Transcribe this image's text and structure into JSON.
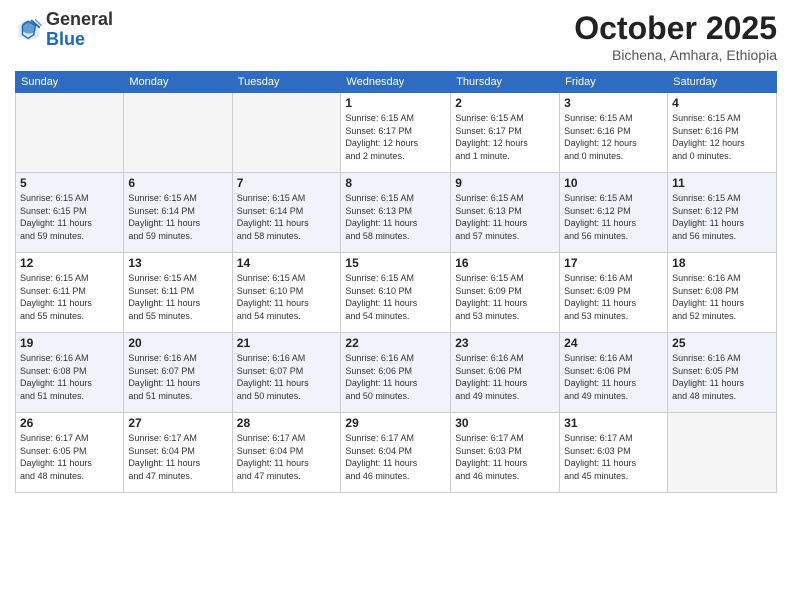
{
  "header": {
    "logo": {
      "line1": "General",
      "line2": "Blue"
    },
    "title": "October 2025",
    "location": "Bichena, Amhara, Ethiopia"
  },
  "weekdays": [
    "Sunday",
    "Monday",
    "Tuesday",
    "Wednesday",
    "Thursday",
    "Friday",
    "Saturday"
  ],
  "weeks": [
    [
      {
        "day": "",
        "info": ""
      },
      {
        "day": "",
        "info": ""
      },
      {
        "day": "",
        "info": ""
      },
      {
        "day": "1",
        "info": "Sunrise: 6:15 AM\nSunset: 6:17 PM\nDaylight: 12 hours\nand 2 minutes."
      },
      {
        "day": "2",
        "info": "Sunrise: 6:15 AM\nSunset: 6:17 PM\nDaylight: 12 hours\nand 1 minute."
      },
      {
        "day": "3",
        "info": "Sunrise: 6:15 AM\nSunset: 6:16 PM\nDaylight: 12 hours\nand 0 minutes."
      },
      {
        "day": "4",
        "info": "Sunrise: 6:15 AM\nSunset: 6:16 PM\nDaylight: 12 hours\nand 0 minutes."
      }
    ],
    [
      {
        "day": "5",
        "info": "Sunrise: 6:15 AM\nSunset: 6:15 PM\nDaylight: 11 hours\nand 59 minutes."
      },
      {
        "day": "6",
        "info": "Sunrise: 6:15 AM\nSunset: 6:14 PM\nDaylight: 11 hours\nand 59 minutes."
      },
      {
        "day": "7",
        "info": "Sunrise: 6:15 AM\nSunset: 6:14 PM\nDaylight: 11 hours\nand 58 minutes."
      },
      {
        "day": "8",
        "info": "Sunrise: 6:15 AM\nSunset: 6:13 PM\nDaylight: 11 hours\nand 58 minutes."
      },
      {
        "day": "9",
        "info": "Sunrise: 6:15 AM\nSunset: 6:13 PM\nDaylight: 11 hours\nand 57 minutes."
      },
      {
        "day": "10",
        "info": "Sunrise: 6:15 AM\nSunset: 6:12 PM\nDaylight: 11 hours\nand 56 minutes."
      },
      {
        "day": "11",
        "info": "Sunrise: 6:15 AM\nSunset: 6:12 PM\nDaylight: 11 hours\nand 56 minutes."
      }
    ],
    [
      {
        "day": "12",
        "info": "Sunrise: 6:15 AM\nSunset: 6:11 PM\nDaylight: 11 hours\nand 55 minutes."
      },
      {
        "day": "13",
        "info": "Sunrise: 6:15 AM\nSunset: 6:11 PM\nDaylight: 11 hours\nand 55 minutes."
      },
      {
        "day": "14",
        "info": "Sunrise: 6:15 AM\nSunset: 6:10 PM\nDaylight: 11 hours\nand 54 minutes."
      },
      {
        "day": "15",
        "info": "Sunrise: 6:15 AM\nSunset: 6:10 PM\nDaylight: 11 hours\nand 54 minutes."
      },
      {
        "day": "16",
        "info": "Sunrise: 6:15 AM\nSunset: 6:09 PM\nDaylight: 11 hours\nand 53 minutes."
      },
      {
        "day": "17",
        "info": "Sunrise: 6:16 AM\nSunset: 6:09 PM\nDaylight: 11 hours\nand 53 minutes."
      },
      {
        "day": "18",
        "info": "Sunrise: 6:16 AM\nSunset: 6:08 PM\nDaylight: 11 hours\nand 52 minutes."
      }
    ],
    [
      {
        "day": "19",
        "info": "Sunrise: 6:16 AM\nSunset: 6:08 PM\nDaylight: 11 hours\nand 51 minutes."
      },
      {
        "day": "20",
        "info": "Sunrise: 6:16 AM\nSunset: 6:07 PM\nDaylight: 11 hours\nand 51 minutes."
      },
      {
        "day": "21",
        "info": "Sunrise: 6:16 AM\nSunset: 6:07 PM\nDaylight: 11 hours\nand 50 minutes."
      },
      {
        "day": "22",
        "info": "Sunrise: 6:16 AM\nSunset: 6:06 PM\nDaylight: 11 hours\nand 50 minutes."
      },
      {
        "day": "23",
        "info": "Sunrise: 6:16 AM\nSunset: 6:06 PM\nDaylight: 11 hours\nand 49 minutes."
      },
      {
        "day": "24",
        "info": "Sunrise: 6:16 AM\nSunset: 6:06 PM\nDaylight: 11 hours\nand 49 minutes."
      },
      {
        "day": "25",
        "info": "Sunrise: 6:16 AM\nSunset: 6:05 PM\nDaylight: 11 hours\nand 48 minutes."
      }
    ],
    [
      {
        "day": "26",
        "info": "Sunrise: 6:17 AM\nSunset: 6:05 PM\nDaylight: 11 hours\nand 48 minutes."
      },
      {
        "day": "27",
        "info": "Sunrise: 6:17 AM\nSunset: 6:04 PM\nDaylight: 11 hours\nand 47 minutes."
      },
      {
        "day": "28",
        "info": "Sunrise: 6:17 AM\nSunset: 6:04 PM\nDaylight: 11 hours\nand 47 minutes."
      },
      {
        "day": "29",
        "info": "Sunrise: 6:17 AM\nSunset: 6:04 PM\nDaylight: 11 hours\nand 46 minutes."
      },
      {
        "day": "30",
        "info": "Sunrise: 6:17 AM\nSunset: 6:03 PM\nDaylight: 11 hours\nand 46 minutes."
      },
      {
        "day": "31",
        "info": "Sunrise: 6:17 AM\nSunset: 6:03 PM\nDaylight: 11 hours\nand 45 minutes."
      },
      {
        "day": "",
        "info": ""
      }
    ]
  ]
}
